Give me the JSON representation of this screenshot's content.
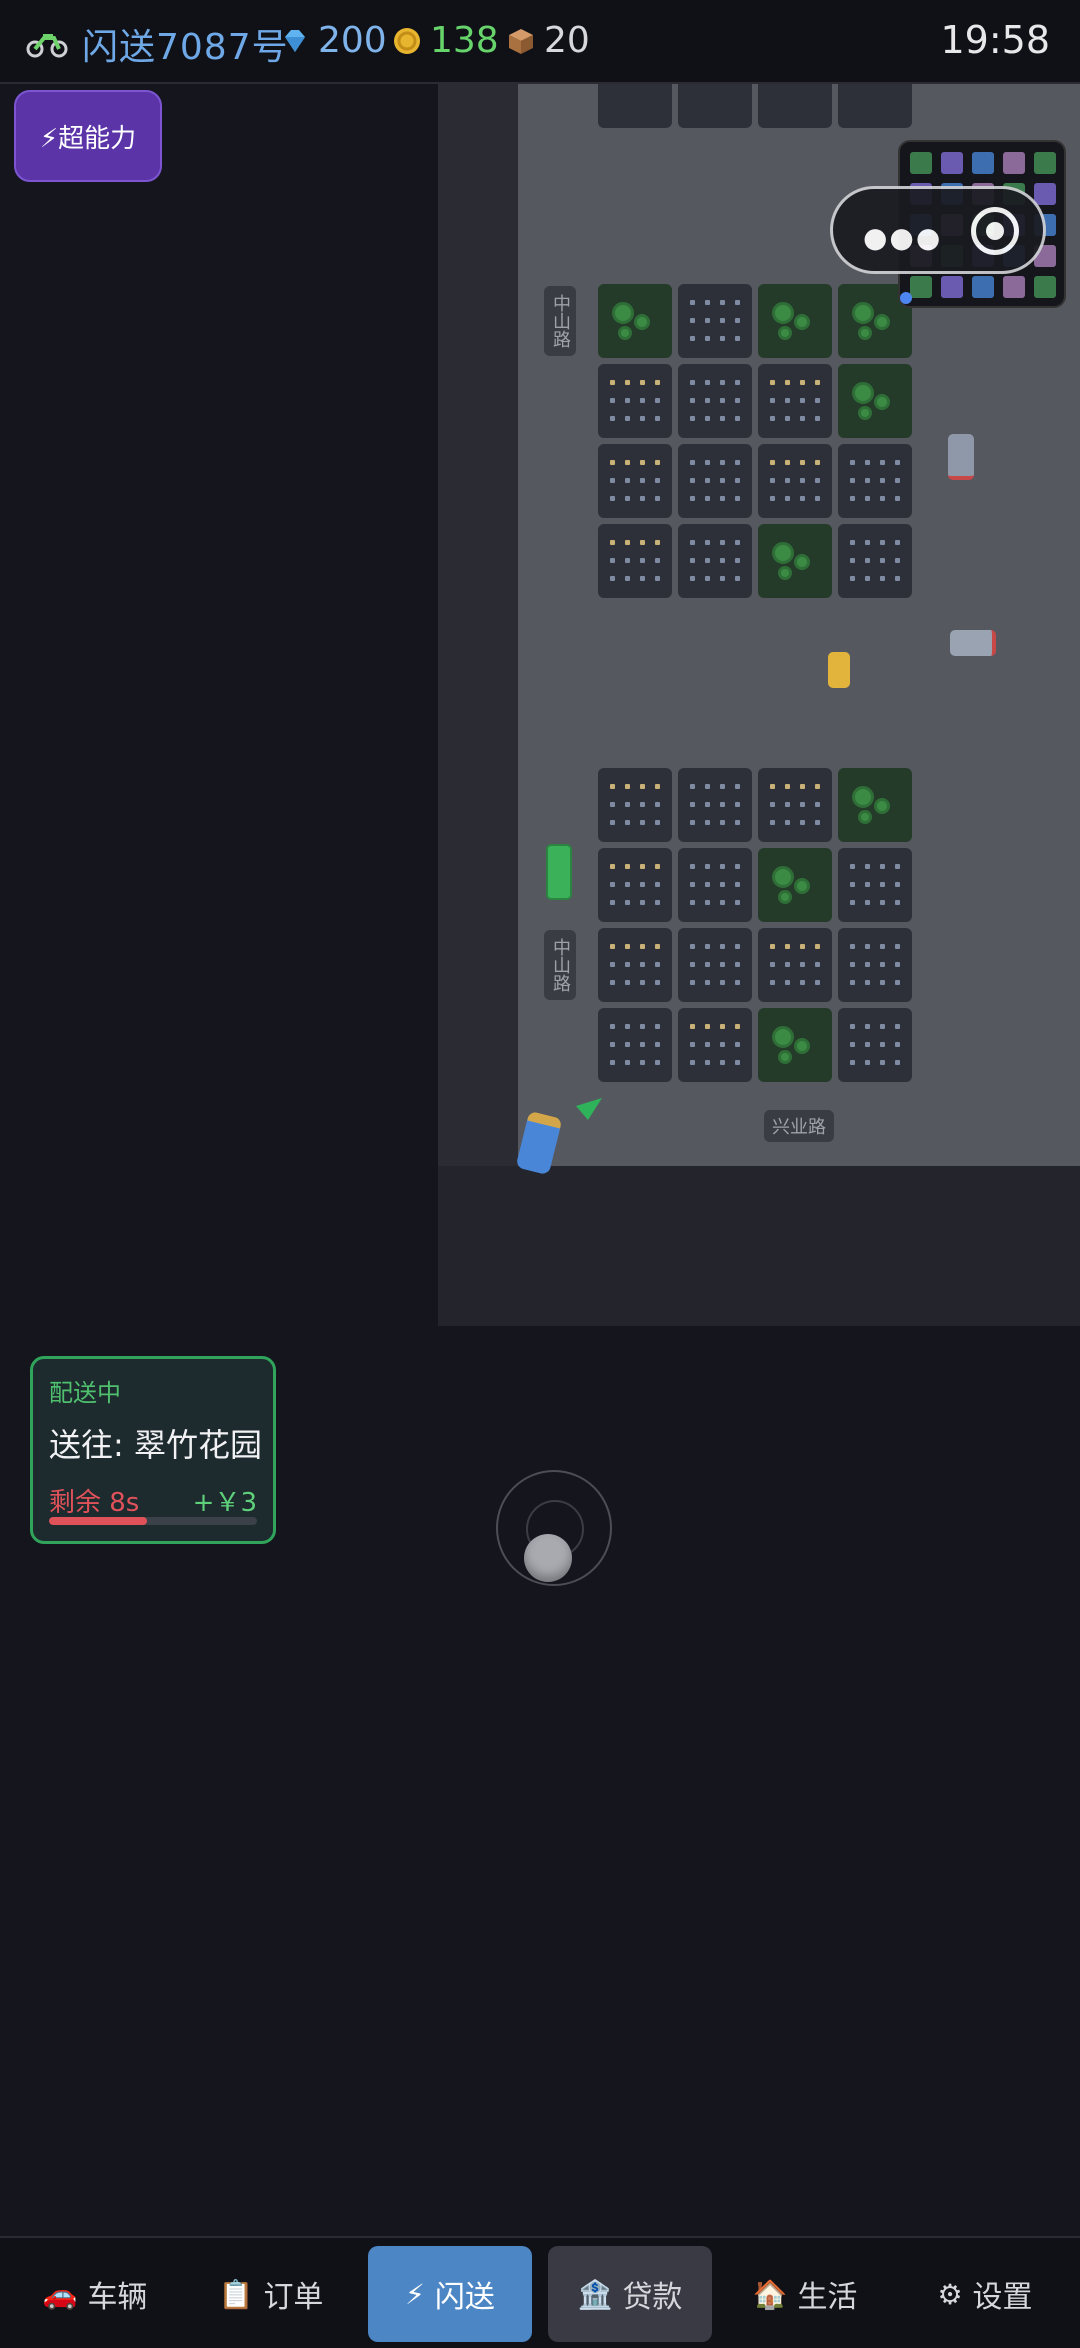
{
  "hud": {
    "player_name": "闪送7087号",
    "gems": "200",
    "coins": "138",
    "packages": "20",
    "time": "19:58"
  },
  "power_button": {
    "label": "⚡超能力"
  },
  "map": {
    "road_labels": {
      "vertical_top": "中山路",
      "vertical_bottom": "中山路",
      "horizontal": "兴业路"
    }
  },
  "delivery": {
    "status": "配送中",
    "destination": "送往: 翠竹花园",
    "time_left": "剩余 8s",
    "reward": "+￥3",
    "progress": 0.47
  },
  "nav": {
    "items": [
      {
        "icon": "🚗",
        "label": "车辆"
      },
      {
        "icon": "📋",
        "label": "订单"
      },
      {
        "icon": "⚡",
        "label": "闪送"
      },
      {
        "icon": "🏦",
        "label": "贷款"
      },
      {
        "icon": "🏠",
        "label": "生活"
      },
      {
        "icon": "⚙",
        "label": "设置"
      }
    ]
  },
  "colors": {
    "accent_blue": "#4d86c4",
    "power_purple": "#5b34a8",
    "delivery_green": "#2fa45a",
    "timer_red": "#e0525a"
  }
}
